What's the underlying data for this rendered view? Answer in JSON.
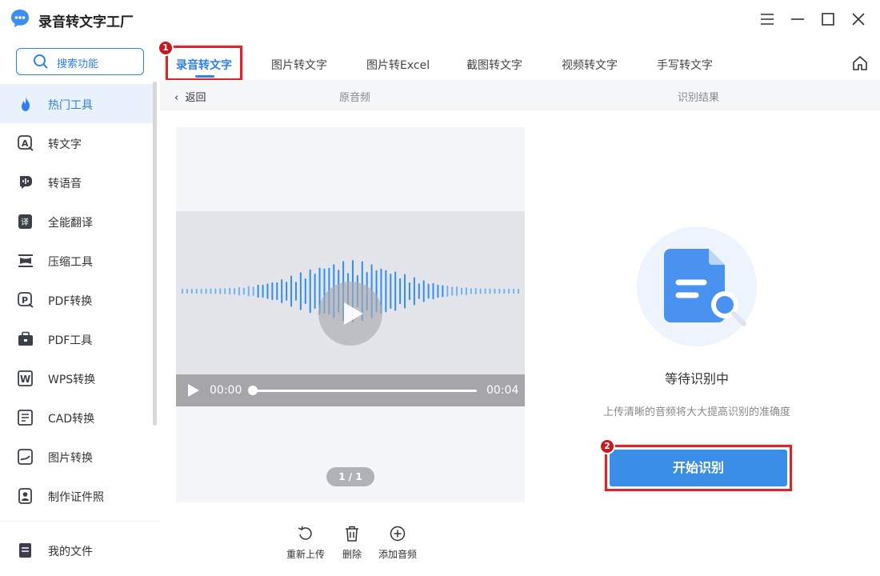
{
  "app": {
    "title": "录音转文字工厂",
    "accent_color": "#2f80ed",
    "highlight_color": "#d9262c"
  },
  "window_controls": [
    "menu-icon",
    "minimize-icon",
    "maximize-icon",
    "close-icon"
  ],
  "sidebar": {
    "search_label": "搜索功能",
    "items": [
      {
        "label": "热门工具",
        "icon": "flame-icon"
      },
      {
        "label": "转文字",
        "icon": "text-convert-icon"
      },
      {
        "label": "转语音",
        "icon": "voice-icon"
      },
      {
        "label": "全能翻译",
        "icon": "translate-icon"
      },
      {
        "label": "压缩工具",
        "icon": "compress-icon"
      },
      {
        "label": "PDF转换",
        "icon": "pdf-convert-icon"
      },
      {
        "label": "PDF工具",
        "icon": "toolbox-icon"
      },
      {
        "label": "WPS转换",
        "icon": "wps-icon"
      },
      {
        "label": "CAD转换",
        "icon": "cad-icon"
      },
      {
        "label": "图片转换",
        "icon": "image-icon"
      },
      {
        "label": "制作证件照",
        "icon": "id-photo-icon"
      }
    ],
    "footer_item": {
      "label": "我的文件",
      "icon": "file-icon"
    }
  },
  "tabs": [
    {
      "label": "录音转文字",
      "active": true
    },
    {
      "label": "图片转文字"
    },
    {
      "label": "图片转Excel"
    },
    {
      "label": "截图转文字"
    },
    {
      "label": "视频转文字"
    },
    {
      "label": "手写转文字"
    }
  ],
  "badges": {
    "first": "1",
    "second": "2"
  },
  "subbar": {
    "back_label": "返回",
    "left_title": "原音频",
    "right_title": "识别结果"
  },
  "player": {
    "current_time": "00:00",
    "duration": "00:04",
    "progress": 0,
    "page_indicator": "1 / 1"
  },
  "actions": [
    {
      "label": "重新上传",
      "icon": "reload-icon"
    },
    {
      "label": "删除",
      "icon": "trash-icon"
    },
    {
      "label": "添加音频",
      "icon": "add-circle-icon"
    }
  ],
  "result": {
    "status": "等待识别中",
    "hint": "上传清晰的音频将大大提高识别的准确度",
    "start_button": "开始识别"
  }
}
